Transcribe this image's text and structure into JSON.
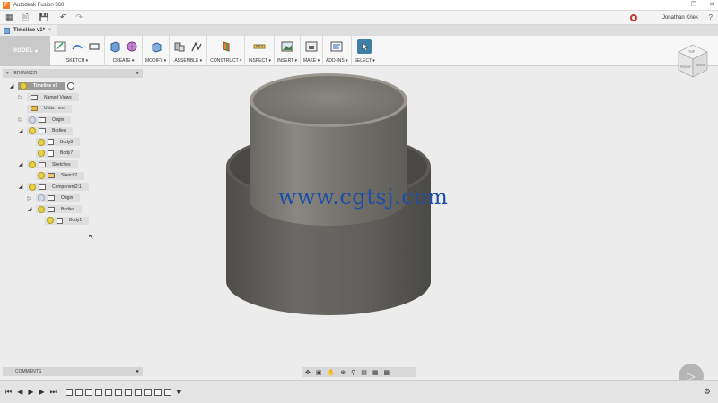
{
  "window": {
    "title": "Autodesk Fusion 360",
    "app_icon": "F"
  },
  "qat": {
    "user_name": "Jonathan Kriek",
    "help_icon": "?"
  },
  "tabs": [
    {
      "label": "Timeline v1*"
    }
  ],
  "toolbar": {
    "model_label": "MODEL",
    "groups": [
      {
        "label": "SKETCH ▾",
        "icons": [
          "sketch-create-icon",
          "line-icon",
          "rectangle-icon"
        ]
      },
      {
        "label": "CREATE ▾",
        "icons": [
          "box-icon",
          "form-icon"
        ]
      },
      {
        "label": "MODIFY ▾",
        "icons": [
          "press-pull-icon"
        ]
      },
      {
        "label": "ASSEMBLE ▾",
        "icons": [
          "new-component-icon",
          "joint-icon"
        ]
      },
      {
        "label": "CONSTRUCT ▾",
        "icons": [
          "plane-icon"
        ]
      },
      {
        "label": "INSPECT ▾",
        "icons": [
          "measure-icon"
        ]
      },
      {
        "label": "INSERT ▾",
        "icons": [
          "insert-image-icon"
        ]
      },
      {
        "label": "MAKE ▾",
        "icons": [
          "3d-print-icon"
        ]
      },
      {
        "label": "ADD-INS ▾",
        "icons": [
          "scripts-icon"
        ]
      },
      {
        "label": "SELECT ▾",
        "icons": [
          "select-icon"
        ]
      }
    ]
  },
  "browser": {
    "title": "BROWSER",
    "items": [
      {
        "label": "Timeline v1",
        "indent": 0,
        "expander": "◢",
        "bulb": true,
        "icon": "none",
        "root": true
      },
      {
        "label": "Named Views",
        "indent": 1,
        "expander": "▷",
        "bulb": false,
        "icon": "folder"
      },
      {
        "label": "Units: mm",
        "indent": 1,
        "expander": "",
        "bulb": false,
        "icon": "units"
      },
      {
        "label": "Origin",
        "indent": 1,
        "expander": "▷",
        "bulb": "off",
        "icon": "folder"
      },
      {
        "label": "Bodies",
        "indent": 1,
        "expander": "◢",
        "bulb": true,
        "icon": "folder"
      },
      {
        "label": "Body8",
        "indent": 2,
        "expander": "",
        "bulb": true,
        "icon": "body"
      },
      {
        "label": "Body7",
        "indent": 2,
        "expander": "",
        "bulb": true,
        "icon": "body"
      },
      {
        "label": "Sketches",
        "indent": 1,
        "expander": "◢",
        "bulb": true,
        "icon": "folder"
      },
      {
        "label": "Sketch2",
        "indent": 2,
        "expander": "",
        "bulb": true,
        "icon": "sketch"
      },
      {
        "label": "Component2:1",
        "indent": 1,
        "expander": "◢",
        "bulb": true,
        "icon": "component"
      },
      {
        "label": "Origin",
        "indent": 2,
        "expander": "▷",
        "bulb": "off",
        "icon": "folder"
      },
      {
        "label": "Bodies",
        "indent": 2,
        "expander": "◢",
        "bulb": true,
        "icon": "folder"
      },
      {
        "label": "Body1",
        "indent": 3,
        "expander": "",
        "bulb": true,
        "icon": "body"
      }
    ]
  },
  "comments": {
    "title": "COMMENTS"
  },
  "viewcube": {
    "face_front": "FRONT",
    "face_right": "RIGHT",
    "face_top": "TOP"
  },
  "watermark": "www.cgtsj.com",
  "colors": {
    "model_body": "#6e6c68",
    "accent": "#f47b20",
    "watermark": "#1d4fa6"
  }
}
